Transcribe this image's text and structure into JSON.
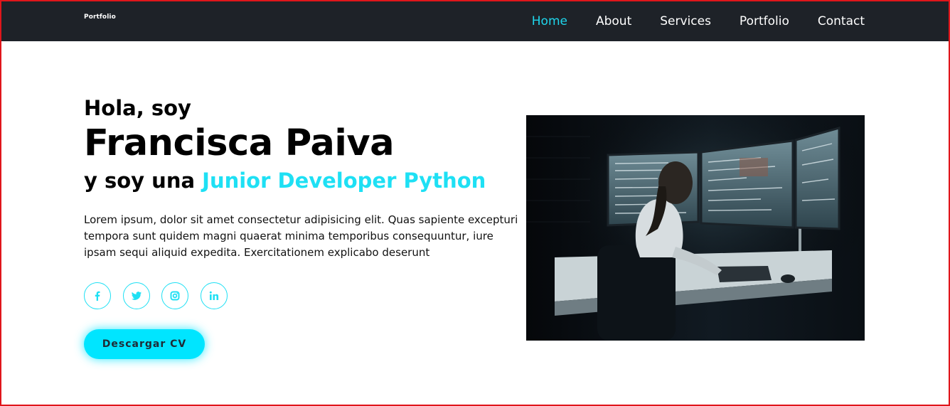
{
  "nav": {
    "logo": "Portfolio",
    "links": [
      "Home",
      "About",
      "Services",
      "Portfolio",
      "Contact"
    ],
    "active": "Home"
  },
  "hero": {
    "greeting": "Hola, soy",
    "name": "Francisca Paiva",
    "role_prefix": "y soy una ",
    "role_highlight": "Junior Developer Python",
    "description": "Lorem ipsum, dolor sit amet consectetur adipisicing elit. Quas sapiente excepturi tempora sunt quidem magni quaerat minima temporibus consequuntur, iure ipsam sequi aliquid expedita. Exercitationem explicabo deserunt",
    "socials": [
      "facebook-icon",
      "twitter-icon",
      "instagram-icon",
      "linkedin-icon"
    ],
    "cv_button": "Descargar CV"
  },
  "colors": {
    "accent": "#1ee0f4",
    "nav_bg": "#1e2228",
    "button_bg": "#00e5ff",
    "border": "#e0161b"
  }
}
